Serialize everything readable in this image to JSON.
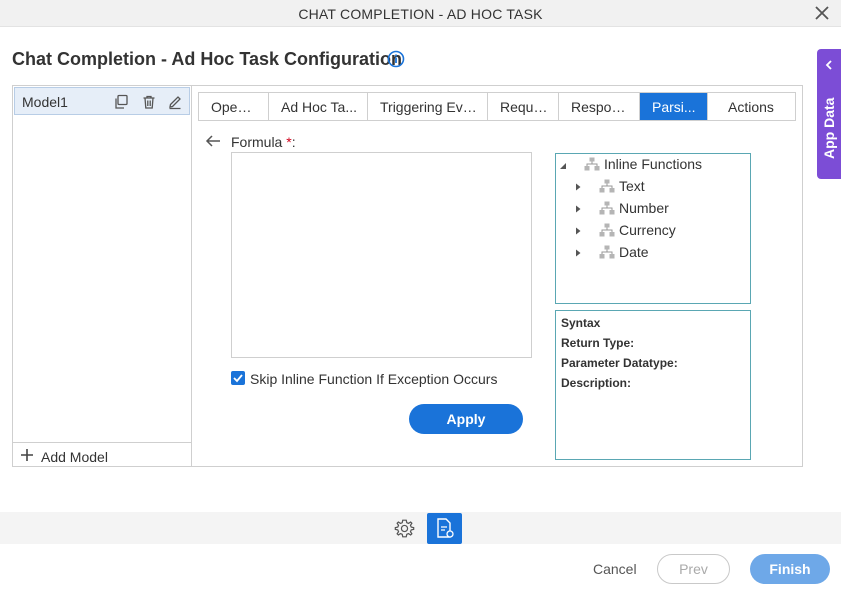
{
  "window": {
    "title": "CHAT COMPLETION - AD HOC TASK"
  },
  "page": {
    "title": "Chat Completion - Ad Hoc Task Configuration"
  },
  "app_data": {
    "label": "App Data"
  },
  "models": {
    "items": [
      {
        "name": "Model1"
      }
    ],
    "add_label": "Add Model"
  },
  "tabs": [
    {
      "label": "OpenAI",
      "active": false
    },
    {
      "label": "Ad Hoc Ta...",
      "active": false
    },
    {
      "label": "Triggering Eve...",
      "active": false
    },
    {
      "label": "Reque...",
      "active": false
    },
    {
      "label": "Respon...",
      "active": false
    },
    {
      "label": "Parsi...",
      "active": true
    },
    {
      "label": "Actions",
      "active": false
    }
  ],
  "formula": {
    "label": "Formula",
    "required_mark": "*",
    "colon": ":",
    "value": ""
  },
  "skip_inline": {
    "label": "Skip Inline Function If Exception Occurs",
    "checked": true
  },
  "apply_label": "Apply",
  "functions_tree": {
    "root": "Inline Functions",
    "children": [
      "Text",
      "Number",
      "Currency",
      "Date"
    ]
  },
  "syntax_panel": {
    "syntax": "Syntax",
    "return_type": "Return Type:",
    "parameter_datatype": "Parameter Datatype:",
    "description": "Description:"
  },
  "footer": {
    "cancel": "Cancel",
    "prev": "Prev",
    "finish": "Finish"
  },
  "colors": {
    "accent": "#1a73d9",
    "app_data": "#7c4dd6",
    "finish_disabled": "#6ea8e8",
    "required": "#d0021b"
  }
}
